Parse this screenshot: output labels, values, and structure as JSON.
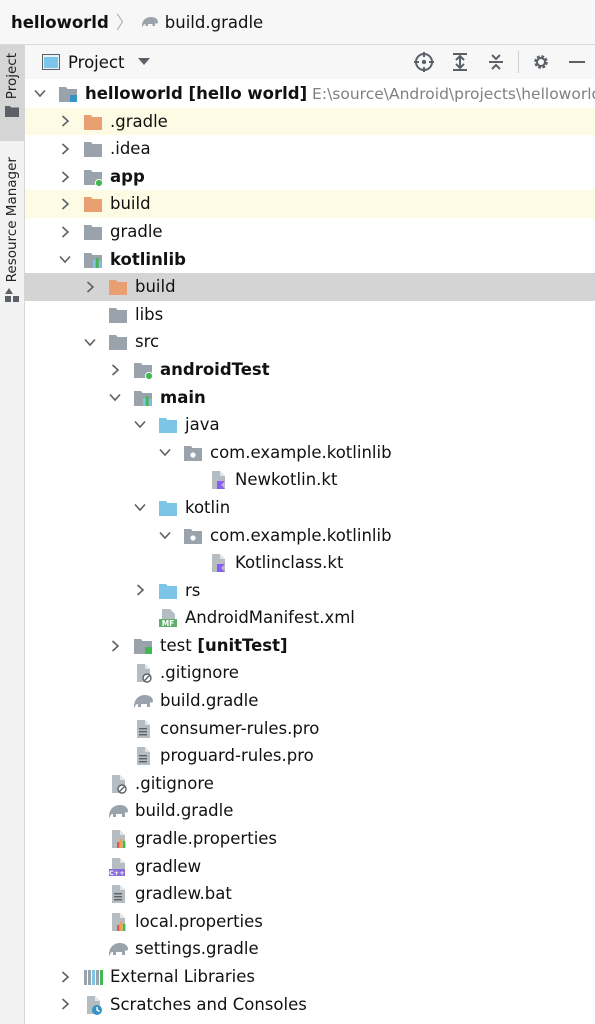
{
  "breadcrumb": {
    "root": "helloworld",
    "file": "build.gradle"
  },
  "toolstrip": {
    "project_tab": "Project",
    "resource_manager_tab": "Resource Manager"
  },
  "panel": {
    "view_label": "Project"
  },
  "tree": [
    {
      "depth": 0,
      "chev": "down",
      "icon": "module-folder",
      "label": "helloworld",
      "bold": true,
      "suffix": "[hello world]",
      "path": "E:\\source\\Android\\projects\\helloworld",
      "hl": ""
    },
    {
      "depth": 1,
      "chev": "right",
      "icon": "folder-orange",
      "label": ".gradle",
      "bold": false,
      "hl": "yellow"
    },
    {
      "depth": 1,
      "chev": "right",
      "icon": "folder-gray",
      "label": ".idea",
      "bold": false,
      "hl": ""
    },
    {
      "depth": 1,
      "chev": "right",
      "icon": "folder-app",
      "label": "app",
      "bold": true,
      "hl": ""
    },
    {
      "depth": 1,
      "chev": "right",
      "icon": "folder-orange",
      "label": "build",
      "bold": false,
      "hl": "yellow"
    },
    {
      "depth": 1,
      "chev": "right",
      "icon": "folder-gray",
      "label": "gradle",
      "bold": false,
      "hl": ""
    },
    {
      "depth": 1,
      "chev": "down",
      "icon": "folder-lib",
      "label": "kotlinlib",
      "bold": true,
      "hl": ""
    },
    {
      "depth": 2,
      "chev": "right",
      "icon": "folder-orange",
      "label": "build",
      "bold": false,
      "hl": "selected"
    },
    {
      "depth": 2,
      "chev": "",
      "icon": "folder-gray",
      "label": "libs",
      "bold": false,
      "hl": ""
    },
    {
      "depth": 2,
      "chev": "down",
      "icon": "folder-gray",
      "label": "src",
      "bold": false,
      "hl": ""
    },
    {
      "depth": 3,
      "chev": "right",
      "icon": "folder-app",
      "label": "androidTest",
      "bold": true,
      "hl": ""
    },
    {
      "depth": 3,
      "chev": "down",
      "icon": "folder-lib",
      "label": "main",
      "bold": true,
      "hl": ""
    },
    {
      "depth": 4,
      "chev": "down",
      "icon": "folder-blue",
      "label": "java",
      "bold": false,
      "hl": ""
    },
    {
      "depth": 5,
      "chev": "down",
      "icon": "package",
      "label": "com.example.kotlinlib",
      "bold": false,
      "hl": ""
    },
    {
      "depth": 6,
      "chev": "",
      "icon": "kotlin-file",
      "label": "Newkotlin.kt",
      "bold": false,
      "hl": ""
    },
    {
      "depth": 4,
      "chev": "down",
      "icon": "folder-blue",
      "label": "kotlin",
      "bold": false,
      "hl": ""
    },
    {
      "depth": 5,
      "chev": "down",
      "icon": "package",
      "label": "com.example.kotlinlib",
      "bold": false,
      "hl": ""
    },
    {
      "depth": 6,
      "chev": "",
      "icon": "kotlin-file",
      "label": "Kotlinclass.kt",
      "bold": false,
      "hl": ""
    },
    {
      "depth": 4,
      "chev": "right",
      "icon": "folder-blue",
      "label": "rs",
      "bold": false,
      "hl": ""
    },
    {
      "depth": 4,
      "chev": "",
      "icon": "manifest-file",
      "label": "AndroidManifest.xml",
      "bold": false,
      "hl": ""
    },
    {
      "depth": 3,
      "chev": "right",
      "icon": "folder-test",
      "label": "test",
      "bold": false,
      "suffix": "[unitTest]",
      "hl": ""
    },
    {
      "depth": 3,
      "chev": "",
      "icon": "gitignore-file",
      "label": ".gitignore",
      "bold": false,
      "hl": ""
    },
    {
      "depth": 3,
      "chev": "",
      "icon": "gradle-file",
      "label": "build.gradle",
      "bold": false,
      "hl": ""
    },
    {
      "depth": 3,
      "chev": "",
      "icon": "text-file",
      "label": "consumer-rules.pro",
      "bold": false,
      "hl": ""
    },
    {
      "depth": 3,
      "chev": "",
      "icon": "text-file",
      "label": "proguard-rules.pro",
      "bold": false,
      "hl": ""
    },
    {
      "depth": 2,
      "chev": "",
      "icon": "gitignore-file",
      "label": ".gitignore",
      "bold": false,
      "hl": ""
    },
    {
      "depth": 2,
      "chev": "",
      "icon": "gradle-file",
      "label": "build.gradle",
      "bold": false,
      "hl": ""
    },
    {
      "depth": 2,
      "chev": "",
      "icon": "properties-file",
      "label": "gradle.properties",
      "bold": false,
      "hl": ""
    },
    {
      "depth": 2,
      "chev": "",
      "icon": "shell-file",
      "label": "gradlew",
      "bold": false,
      "hl": ""
    },
    {
      "depth": 2,
      "chev": "",
      "icon": "text-file",
      "label": "gradlew.bat",
      "bold": false,
      "hl": ""
    },
    {
      "depth": 2,
      "chev": "",
      "icon": "properties-file",
      "label": "local.properties",
      "bold": false,
      "hl": ""
    },
    {
      "depth": 2,
      "chev": "",
      "icon": "gradle-file",
      "label": "settings.gradle",
      "bold": false,
      "hl": ""
    },
    {
      "depth": 1,
      "chev": "right",
      "icon": "libraries",
      "label": "External Libraries",
      "bold": false,
      "hl": ""
    },
    {
      "depth": 1,
      "chev": "right",
      "icon": "scratches",
      "label": "Scratches and Consoles",
      "bold": false,
      "hl": ""
    }
  ],
  "colors": {
    "folder_gray": "#9aa3ab",
    "folder_orange": "#e8a073",
    "folder_blue": "#7cc4e8",
    "module_green": "#3fb950",
    "kotlin_purple": "#8a5cf6",
    "highlight_yellow": "#fdfbe3",
    "selected_gray": "#d4d4d4"
  }
}
